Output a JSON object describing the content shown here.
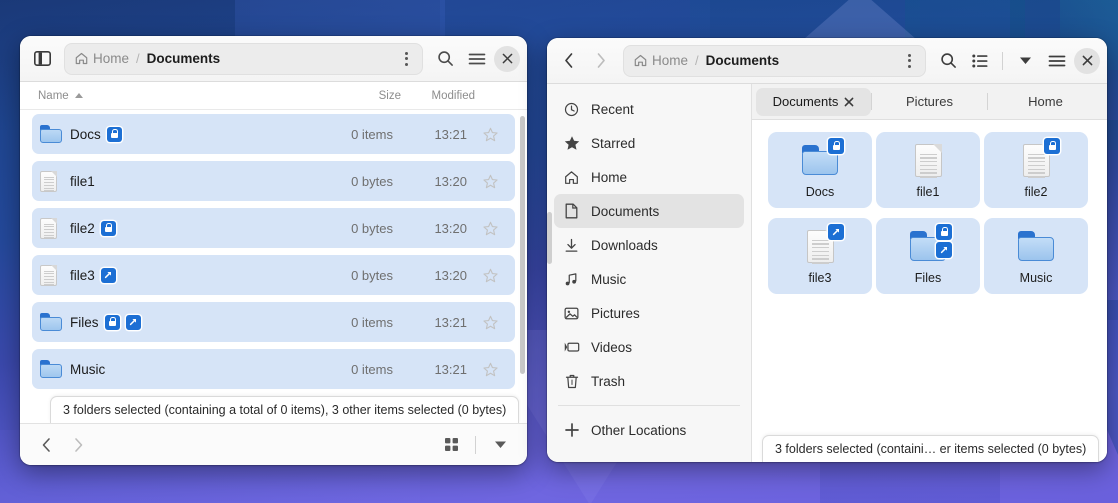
{
  "left_window": {
    "sidebar_toggle_icon": "sidebar-toggle-icon",
    "breadcrumb": {
      "home": "Home",
      "separator": "/",
      "current": "Documents"
    },
    "menu_dots_icon": "view-options-icon",
    "search_icon": "search-icon",
    "hamburger_icon": "main-menu-icon",
    "close_icon": "close-icon",
    "columns": {
      "name": "Name",
      "size": "Size",
      "modified": "Modified"
    },
    "sort_order": "ascending",
    "rows": [
      {
        "name": "Docs",
        "type": "folder",
        "size": "0 items",
        "modified": "13:21",
        "selected": true,
        "emblems": [
          "lock"
        ]
      },
      {
        "name": "file1",
        "type": "document",
        "size": "0 bytes",
        "modified": "13:20",
        "selected": true,
        "emblems": []
      },
      {
        "name": "file2",
        "type": "document",
        "size": "0 bytes",
        "modified": "13:20",
        "selected": true,
        "emblems": [
          "lock"
        ]
      },
      {
        "name": "file3",
        "type": "document",
        "size": "0 bytes",
        "modified": "13:20",
        "selected": true,
        "emblems": [
          "link"
        ]
      },
      {
        "name": "Files",
        "type": "folder",
        "size": "0 items",
        "modified": "13:21",
        "selected": true,
        "emblems": [
          "lock",
          "link"
        ]
      },
      {
        "name": "Music",
        "type": "folder",
        "size": "0 items",
        "modified": "13:21",
        "selected": true,
        "emblems": []
      }
    ],
    "status": "3 folders selected (containing a total of 0 items), 3 other items selected (0 bytes)",
    "footer": {
      "back_icon": "back-chevron-icon",
      "forward_icon": "forward-chevron-icon",
      "grid_view_icon": "grid-view-icon",
      "dropdown_icon": "chevron-down-icon"
    }
  },
  "right_window": {
    "back_icon": "back-chevron-icon",
    "forward_icon": "forward-chevron-icon",
    "breadcrumb": {
      "home": "Home",
      "separator": "/",
      "current": "Documents"
    },
    "menu_dots_icon": "view-options-icon",
    "search_icon": "search-icon",
    "list_view_icon": "list-view-icon",
    "dropdown_icon": "chevron-down-icon",
    "hamburger_icon": "main-menu-icon",
    "close_icon": "close-icon",
    "sidebar": {
      "items": [
        {
          "label": "Recent",
          "icon": "clock-icon",
          "active": false
        },
        {
          "label": "Starred",
          "icon": "star-icon",
          "active": false
        },
        {
          "label": "Home",
          "icon": "home-icon",
          "active": false
        },
        {
          "label": "Documents",
          "icon": "document-icon",
          "active": true
        },
        {
          "label": "Downloads",
          "icon": "download-icon",
          "active": false
        },
        {
          "label": "Music",
          "icon": "music-icon",
          "active": false
        },
        {
          "label": "Pictures",
          "icon": "image-icon",
          "active": false
        },
        {
          "label": "Videos",
          "icon": "video-icon",
          "active": false
        },
        {
          "label": "Trash",
          "icon": "trash-icon",
          "active": false
        }
      ],
      "other_locations": {
        "label": "Other Locations",
        "icon": "plus-icon"
      }
    },
    "tabs": [
      {
        "label": "Documents",
        "active": true,
        "closable": true
      },
      {
        "label": "Pictures",
        "active": false,
        "closable": false
      },
      {
        "label": "Home",
        "active": false,
        "closable": false
      }
    ],
    "grid_items": [
      {
        "name": "Docs",
        "type": "folder",
        "selected": true,
        "emblems": [
          "lock"
        ]
      },
      {
        "name": "file1",
        "type": "document",
        "selected": true,
        "emblems": []
      },
      {
        "name": "file2",
        "type": "document",
        "selected": true,
        "emblems": [
          "lock"
        ]
      },
      {
        "name": "file3",
        "type": "document",
        "selected": true,
        "emblems": [
          "link"
        ]
      },
      {
        "name": "Files",
        "type": "folder",
        "selected": true,
        "emblems": [
          "lock",
          "link"
        ]
      },
      {
        "name": "Music",
        "type": "folder",
        "selected": true,
        "emblems": []
      }
    ],
    "status": "3 folders selected (containi… er items selected (0 bytes)"
  },
  "colors": {
    "selection_blue": "#d6e4f7",
    "emblem_blue": "#1c6fd4",
    "folder_blue": "#2a72cf",
    "sidebar_bg": "#f7f7f7",
    "header_bg": "#f4f4f4"
  }
}
